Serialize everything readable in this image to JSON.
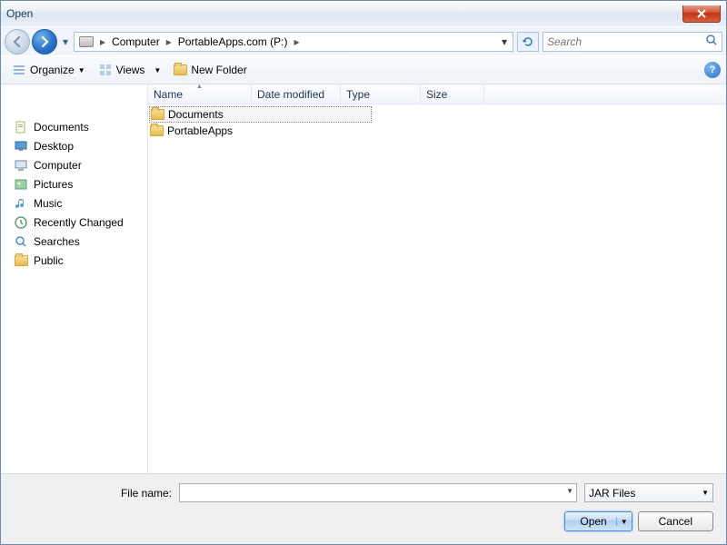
{
  "window": {
    "title": "Open"
  },
  "breadcrumb": {
    "item1": "Computer",
    "item2": "PortableApps.com (P:)"
  },
  "search": {
    "placeholder": "Search"
  },
  "toolbar": {
    "organize": "Organize",
    "views": "Views",
    "newfolder": "New Folder"
  },
  "columns": {
    "name": "Name",
    "date": "Date modified",
    "type": "Type",
    "size": "Size"
  },
  "sidebar": {
    "items": [
      {
        "label": "Documents"
      },
      {
        "label": "Desktop"
      },
      {
        "label": "Computer"
      },
      {
        "label": "Pictures"
      },
      {
        "label": "Music"
      },
      {
        "label": "Recently Changed"
      },
      {
        "label": "Searches"
      },
      {
        "label": "Public"
      }
    ]
  },
  "files": [
    {
      "name": "Documents"
    },
    {
      "name": "PortableApps"
    }
  ],
  "footer": {
    "filename_label": "File name:",
    "filetype": "JAR Files",
    "open": "Open",
    "cancel": "Cancel"
  }
}
